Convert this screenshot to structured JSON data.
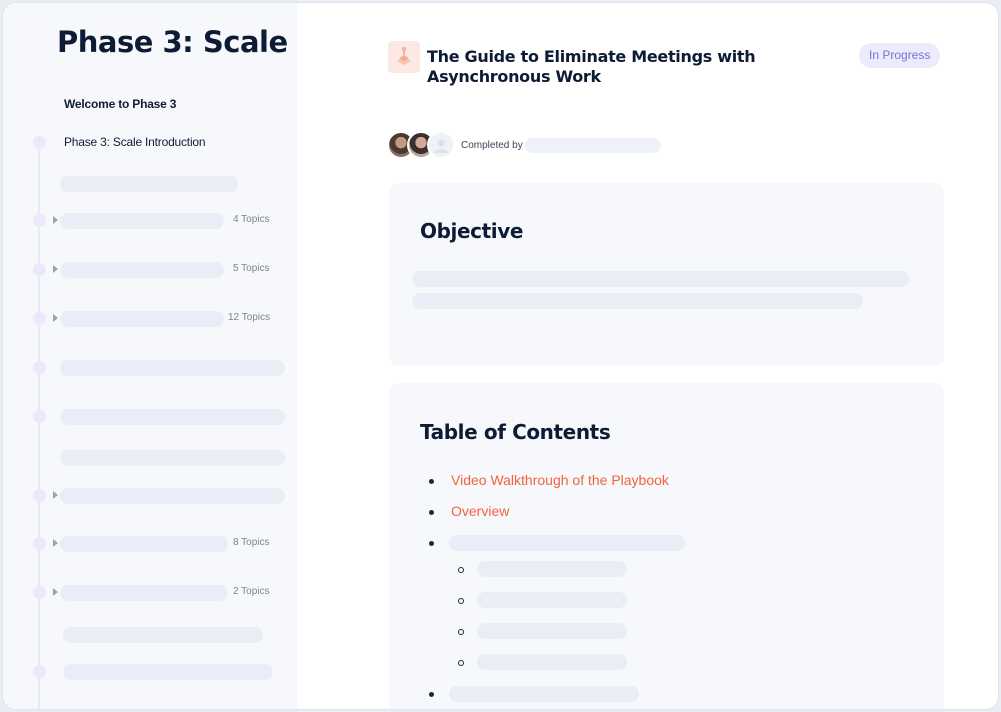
{
  "sidebar": {
    "title": "Phase 3: Scale",
    "items": [
      {
        "label": "Welcome to Phase 3"
      },
      {
        "label": "Phase 3: Scale Introduction"
      },
      {
        "meta": ""
      },
      {
        "meta": "4 Topics"
      },
      {
        "meta": "5 Topics"
      },
      {
        "meta": "12 Topics"
      },
      {
        "meta": ""
      },
      {
        "meta": ""
      },
      {
        "meta": ""
      },
      {
        "meta": ""
      },
      {
        "meta": "8 Topics"
      },
      {
        "meta": "2 Topics"
      },
      {
        "meta": ""
      },
      {
        "meta": ""
      }
    ]
  },
  "course": {
    "title": "The Guide to Eliminate Meetings with Asynchronous Work",
    "status": "In Progress",
    "completed_label": "Completed by"
  },
  "objective": {
    "heading": "Objective"
  },
  "toc": {
    "heading": "Table of Contents",
    "links": [
      "Video Walkthrough of the Playbook",
      "Overview"
    ]
  },
  "colors": {
    "accent_link": "#f0643c",
    "status_badge": "#7b6fd6",
    "heading": "#0d1b34"
  }
}
